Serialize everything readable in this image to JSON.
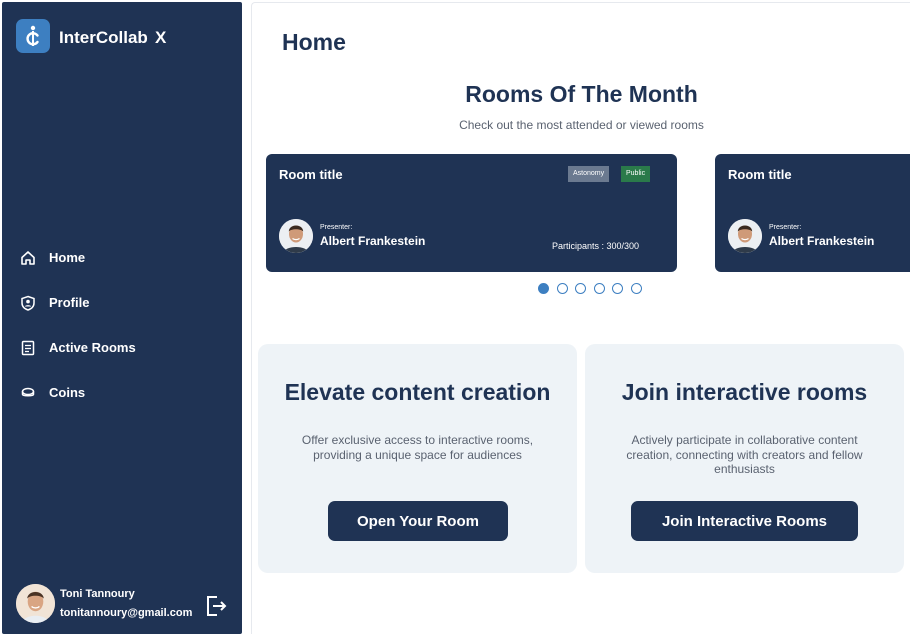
{
  "sidebar": {
    "brand": "InterCollab",
    "close_label": "X",
    "items": [
      {
        "label": "Home",
        "icon": "home-icon"
      },
      {
        "label": "Profile",
        "icon": "profile-shield-icon"
      },
      {
        "label": "Active Rooms",
        "icon": "document-icon"
      },
      {
        "label": "Coins",
        "icon": "coins-icon"
      }
    ],
    "user": {
      "name": "Toni Tannoury",
      "email": "tonitannoury@gmail.com"
    }
  },
  "main": {
    "title": "Home",
    "rooms_section": {
      "title": "Rooms Of The Month",
      "subtitle": "Check out the most attended or viewed rooms",
      "cards": [
        {
          "title": "Room title",
          "topic_tag": "Astonomy",
          "status_tag": "Public",
          "presenter_caption": "Presenter:",
          "presenter": "Albert Frankestein",
          "participants": "Participants : 300/300"
        },
        {
          "title": "Room title",
          "presenter_caption": "Presenter:",
          "presenter": "Albert Frankestein"
        }
      ],
      "carousel": {
        "count": 6,
        "active_index": 0
      }
    },
    "promos": [
      {
        "title": "Elevate content creation",
        "description": "Offer exclusive access to interactive rooms, providing a unique space for audiences",
        "button": "Open Your Room"
      },
      {
        "title": "Join interactive rooms",
        "description": "Actively participate in collaborative content creation, connecting with creators and fellow enthusiasts",
        "button": "Join Interactive Rooms"
      }
    ]
  },
  "colors": {
    "sidebar_bg": "#1f3354",
    "accent": "#3d7fc1",
    "card_bg": "#1f3354",
    "promo_bg": "#eef3f7",
    "public_tag": "#2a7a4a",
    "topic_tag": "#6b7a90"
  }
}
